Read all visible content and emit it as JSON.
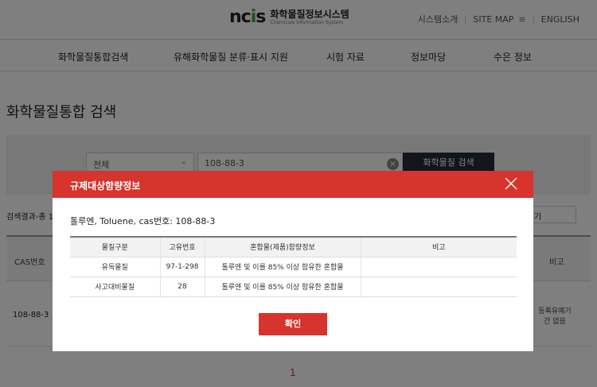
{
  "header": {
    "logo_mark": "ncis",
    "logo_title": "화학물질정보시스템",
    "logo_subtitle": "Chemicals Information System",
    "util_links": [
      "시스템소개",
      "SITE MAP",
      "ENGLISH"
    ],
    "menu_icon": "hamburger-icon"
  },
  "gnb": {
    "items": [
      "화학물질통합검색",
      "유해화학물질 분류·표시 지원",
      "시험 자료",
      "정보마당",
      "수은 정보"
    ]
  },
  "page": {
    "title": "화학물질통합 검색"
  },
  "search": {
    "category": "전체",
    "query": "108-88-3",
    "button": "화학물질 검색"
  },
  "results": {
    "count_label": "검색결과-총 1",
    "sort_label": "기",
    "headers": {
      "cas": "CAS번호",
      "note": "비고"
    },
    "row": {
      "cas": "108-88-3",
      "note": "등록유예기간 없음"
    },
    "page": "1"
  },
  "modal": {
    "title": "규제대상함량정보",
    "description": "톨루엔, Toluene, cas번호: 108-88-3",
    "columns": [
      "물질구분",
      "고유번호",
      "혼합물(제품)함량정보",
      "비고"
    ],
    "rows": [
      [
        "유독물질",
        "97-1-298",
        "톨루엔 및 이를 85% 이상 함유한 혼합물",
        ""
      ],
      [
        "사고대비물질",
        "28",
        "톨루엔 및 이를 85% 이상 함유한 혼합물",
        ""
      ]
    ],
    "confirm": "확인"
  },
  "colors": {
    "accent_red": "#d6342c",
    "search_button": "#252b3d",
    "logo_green": "#2fa84f"
  }
}
